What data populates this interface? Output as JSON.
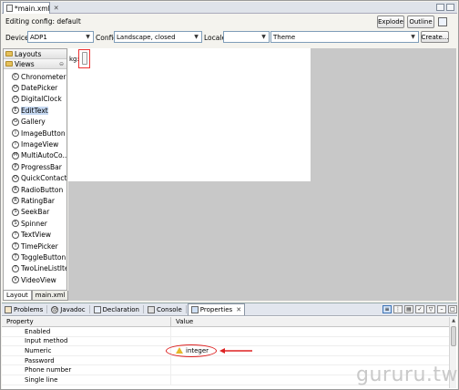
{
  "editor": {
    "tab_label": "*main.xml",
    "close_glyph": "✕"
  },
  "config": {
    "title": "Editing config: default",
    "explode_label": "Explode",
    "outline_label": "Outline",
    "devices_label": "Devices",
    "devices_value": "ADP1",
    "config_label": "Config",
    "config_value": "Landscape, closed",
    "locale_label": "Locale",
    "locale_value": "",
    "theme_value": "Theme",
    "create_label": "Create..."
  },
  "palette": {
    "categories": [
      {
        "label": "Layouts"
      },
      {
        "label": "Views"
      }
    ],
    "items": [
      {
        "label": "Chronometer"
      },
      {
        "label": "DatePicker"
      },
      {
        "label": "DigitalClock"
      },
      {
        "label": "EditText"
      },
      {
        "label": "Gallery"
      },
      {
        "label": "ImageButton"
      },
      {
        "label": "ImageView"
      },
      {
        "label": "MultiAutoCo..."
      },
      {
        "label": "ProgressBar"
      },
      {
        "label": "QuickContact..."
      },
      {
        "label": "RadioButton"
      },
      {
        "label": "RatingBar"
      },
      {
        "label": "SeekBar"
      },
      {
        "label": "Spinner"
      },
      {
        "label": "TextView"
      },
      {
        "label": "TimePicker"
      },
      {
        "label": "ToggleButton"
      },
      {
        "label": "TwoLineListItem"
      },
      {
        "label": "VideoView"
      }
    ],
    "tabs": [
      {
        "label": "Layout"
      },
      {
        "label": "main.xml"
      }
    ]
  },
  "canvas": {
    "text": "kg:"
  },
  "bottom_tabs": [
    {
      "label": "Problems"
    },
    {
      "label": "Javadoc"
    },
    {
      "label": "Declaration"
    },
    {
      "label": "Console"
    },
    {
      "label": "Properties"
    }
  ],
  "properties": {
    "header_property": "Property",
    "header_value": "Value",
    "rows": [
      {
        "name": "Enabled",
        "value": ""
      },
      {
        "name": "Input method",
        "value": ""
      },
      {
        "name": "Numeric",
        "value": "integer"
      },
      {
        "name": "Password",
        "value": ""
      },
      {
        "name": "Phone number",
        "value": ""
      },
      {
        "name": "Single line",
        "value": ""
      }
    ]
  },
  "watermark": "gururu.tw",
  "colors": {
    "highlight": "#dd2222",
    "selection": "#c6d9f2",
    "canvas_bg": "#c8c8c8"
  }
}
